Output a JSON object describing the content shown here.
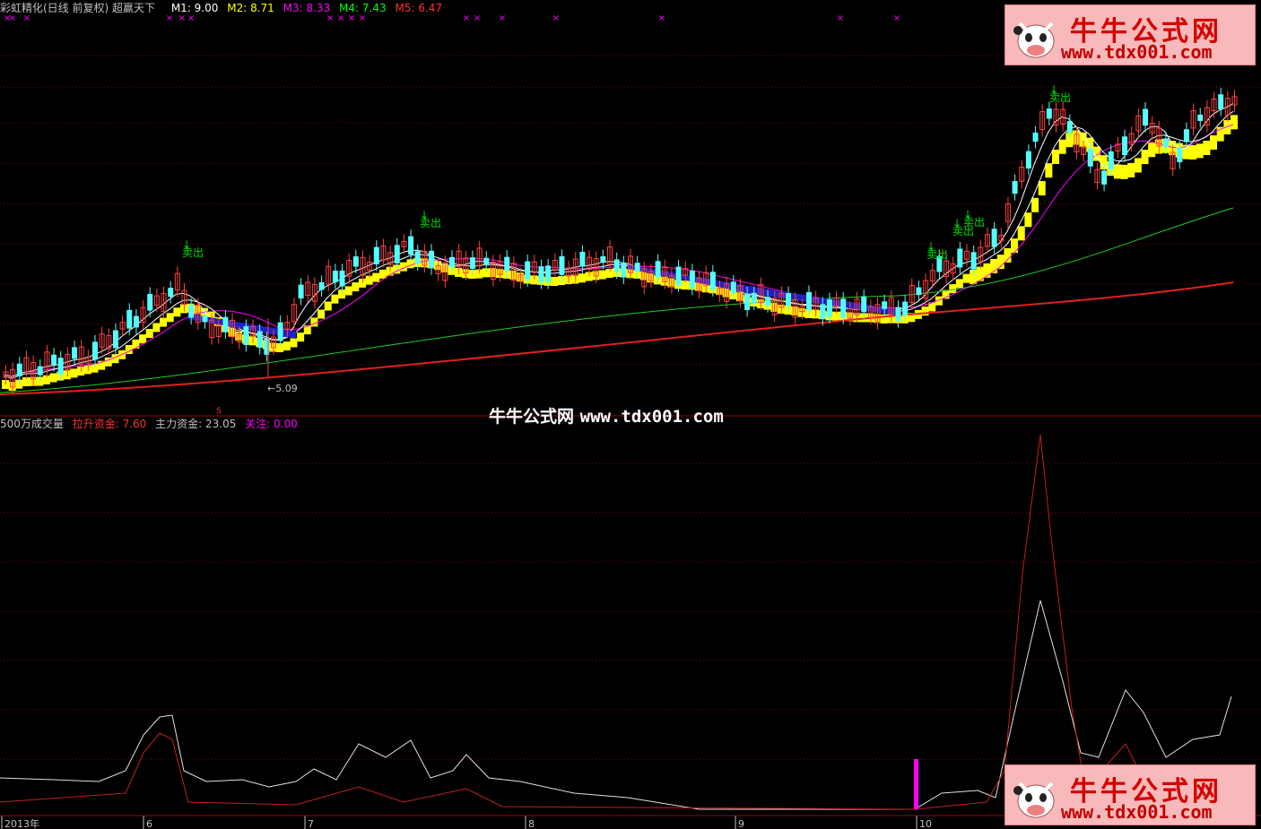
{
  "main_header": {
    "title": "彩虹精化(日线 前复权) 超赢天下",
    "ma": [
      {
        "label": "M1: 9.00",
        "color": "#ffffff"
      },
      {
        "label": "M2: 8.71",
        "color": "#ffff00"
      },
      {
        "label": "M3: 8.33",
        "color": "#ff00ff"
      },
      {
        "label": "M4: 7.43",
        "color": "#00ff00"
      },
      {
        "label": "M5: 6.47",
        "color": "#ff3030"
      }
    ]
  },
  "sub_header": {
    "title": "500万成交量",
    "items": [
      {
        "label": "拉升资金: 7.60",
        "color": "#ff3030"
      },
      {
        "label": "主力资金: 23.05",
        "color": "#c0c0c0"
      },
      {
        "label": "关注: 0.00",
        "color": "#ff00ff"
      }
    ]
  },
  "signals": [
    {
      "label": "卖出",
      "x": 215,
      "y": 286
    },
    {
      "label": "卖出",
      "x": 480,
      "y": 253
    },
    {
      "label": "卖出",
      "x": 1045,
      "y": 288
    },
    {
      "label": "卖出",
      "x": 1074,
      "y": 262
    },
    {
      "label": "卖出",
      "x": 1086,
      "y": 252
    },
    {
      "label": "卖出",
      "x": 1182,
      "y": 113
    }
  ],
  "low_label": "←5.09",
  "s_mark": "S",
  "x_axis_labels": [
    "2013年",
    "6",
    "7",
    "8",
    "9",
    "10"
  ],
  "watermark": {
    "cn": "牛牛公式网",
    "url": "www.tdx001.com"
  },
  "logo": {
    "cn": "牛牛公式网",
    "url": "www.tdx001.com"
  },
  "colors": {
    "up": "#ff4040",
    "down": "#55ffff",
    "ribbon": "#ffff00",
    "grid": "#800000"
  },
  "chart_data": [
    {
      "type": "candlestick",
      "title": "彩虹精化(日线 前复权)",
      "series": [
        {
          "name": "M1",
          "value": 9.0
        },
        {
          "name": "M2",
          "value": 8.71
        },
        {
          "name": "M3",
          "value": 8.33
        },
        {
          "name": "M4",
          "value": 7.43
        },
        {
          "name": "M5",
          "value": 6.47
        }
      ],
      "annotations": [
        "卖出",
        "←5.09"
      ],
      "grid": true
    },
    {
      "type": "line",
      "title": "500万成交量",
      "series": [
        {
          "name": "拉升资金",
          "value": 7.6
        },
        {
          "name": "主力资金",
          "value": 23.05
        },
        {
          "name": "关注",
          "value": 0.0
        }
      ],
      "grid": true
    }
  ]
}
